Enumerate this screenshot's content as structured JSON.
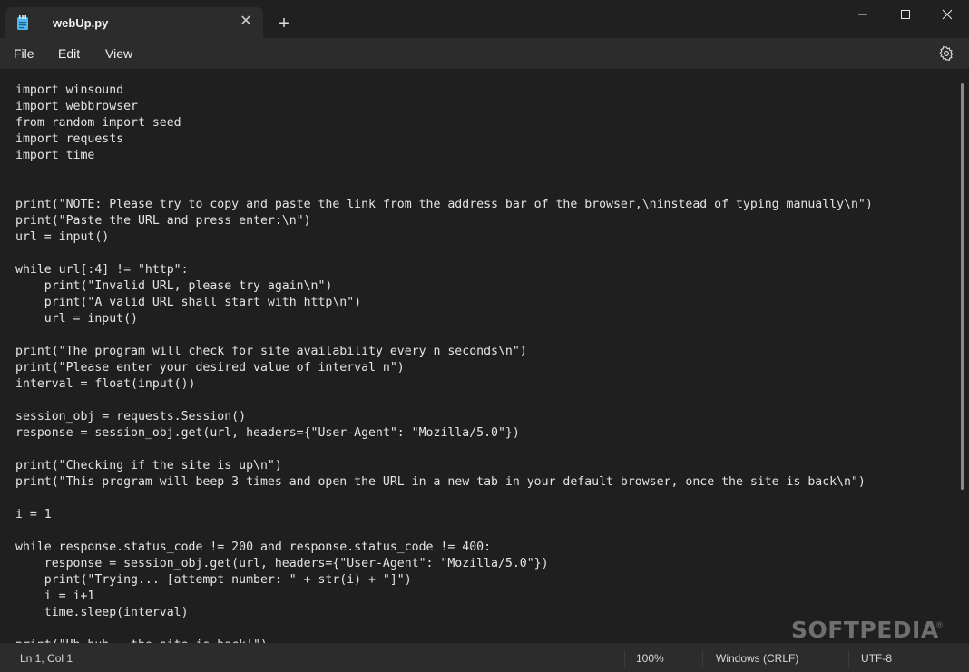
{
  "window": {
    "tab_title": "webUp.py",
    "tab_close_glyph": "✕",
    "new_tab_glyph": "+"
  },
  "menu": {
    "file": "File",
    "edit": "Edit",
    "view": "View"
  },
  "editor": {
    "lines": [
      "import winsound",
      "import webbrowser",
      "from random import seed",
      "import requests",
      "import time",
      "",
      "",
      "print(\"NOTE: Please try to copy and paste the link from the address bar of the browser,\\ninstead of typing manually\\n\")",
      "print(\"Paste the URL and press enter:\\n\")",
      "url = input()",
      "",
      "while url[:4] != \"http\":",
      "    print(\"Invalid URL, please try again\\n\")",
      "    print(\"A valid URL shall start with http\\n\")",
      "    url = input()",
      "",
      "print(\"The program will check for site availability every n seconds\\n\")",
      "print(\"Please enter your desired value of interval n\")",
      "interval = float(input())",
      "",
      "session_obj = requests.Session()",
      "response = session_obj.get(url, headers={\"User-Agent\": \"Mozilla/5.0\"})",
      "",
      "print(\"Checking if the site is up\\n\")",
      "print(\"This program will beep 3 times and open the URL in a new tab in your default browser, once the site is back\\n\")",
      "",
      "i = 1",
      "",
      "while response.status_code != 200 and response.status_code != 400:",
      "    response = session_obj.get(url, headers={\"User-Agent\": \"Mozilla/5.0\"})",
      "    print(\"Trying... [attempt number: \" + str(i) + \"]\")",
      "    i = i+1",
      "    time.sleep(interval)",
      "",
      "print(\"Uh-huh...the site is back!\")"
    ]
  },
  "status": {
    "position": "Ln 1, Col 1",
    "zoom": "100%",
    "line_ending": "Windows (CRLF)",
    "encoding": "UTF-8"
  },
  "watermark": {
    "text": "SOFTPEDIA",
    "mark": "®"
  },
  "colors": {
    "background": "#1f1f1f",
    "chrome": "#2c2c2c",
    "titlebar": "#202020",
    "tab_icon": "#4fb6f0"
  }
}
